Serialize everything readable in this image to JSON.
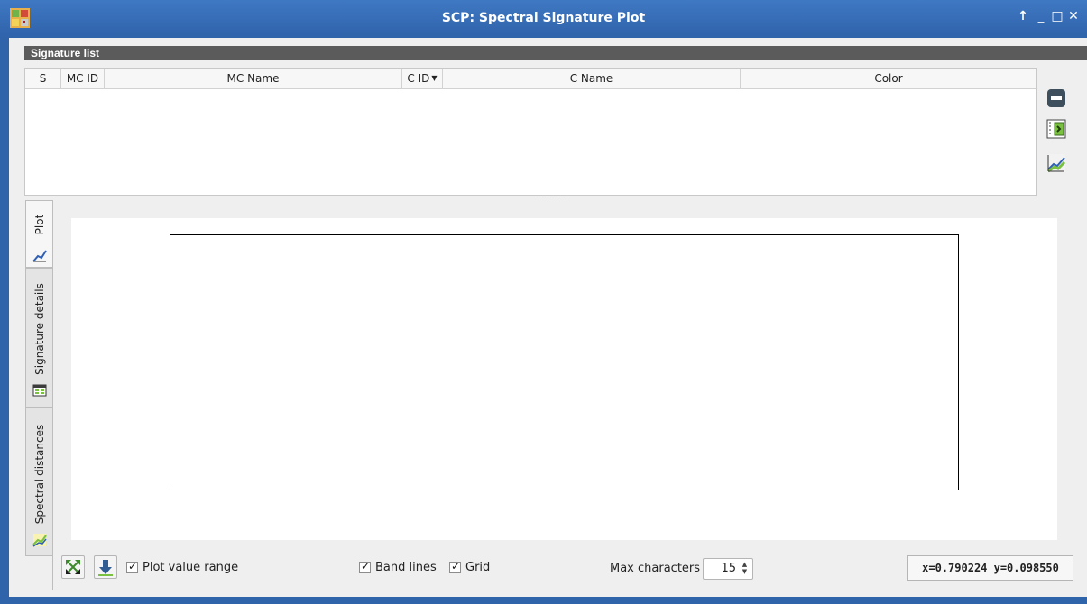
{
  "window": {
    "title": "SCP: Spectral Signature Plot",
    "controls": {
      "pin": "↑",
      "minimize": "_",
      "maximize": "□",
      "close": "✕"
    }
  },
  "signature_list": {
    "header": "Signature list",
    "columns": [
      "S",
      "MC ID",
      "MC Name",
      "C ID",
      "C Name",
      "Color"
    ],
    "sorted_column": "C ID",
    "rows": []
  },
  "side_buttons": [
    {
      "icon": "remove-icon"
    },
    {
      "icon": "import-icon"
    },
    {
      "icon": "plot-icon"
    }
  ],
  "tabs": [
    {
      "label": "Plot",
      "icon": "plot-tab-icon",
      "active": true
    },
    {
      "label": "Signature details",
      "icon": "table-icon",
      "active": false
    },
    {
      "label": "Spectral distances",
      "icon": "distance-icon",
      "active": false
    }
  ],
  "bottom": {
    "plot_value_range_label": "Plot value range",
    "band_lines_label": "Band lines",
    "grid_label": "Grid",
    "max_characters_label": "Max characters",
    "max_characters_value": "15",
    "coords": "x=0.790224 y=0.098550"
  },
  "colors": {
    "titlebar": "#2f63aa",
    "header": "#5b5b5b",
    "accent_green": "#7ac142"
  }
}
